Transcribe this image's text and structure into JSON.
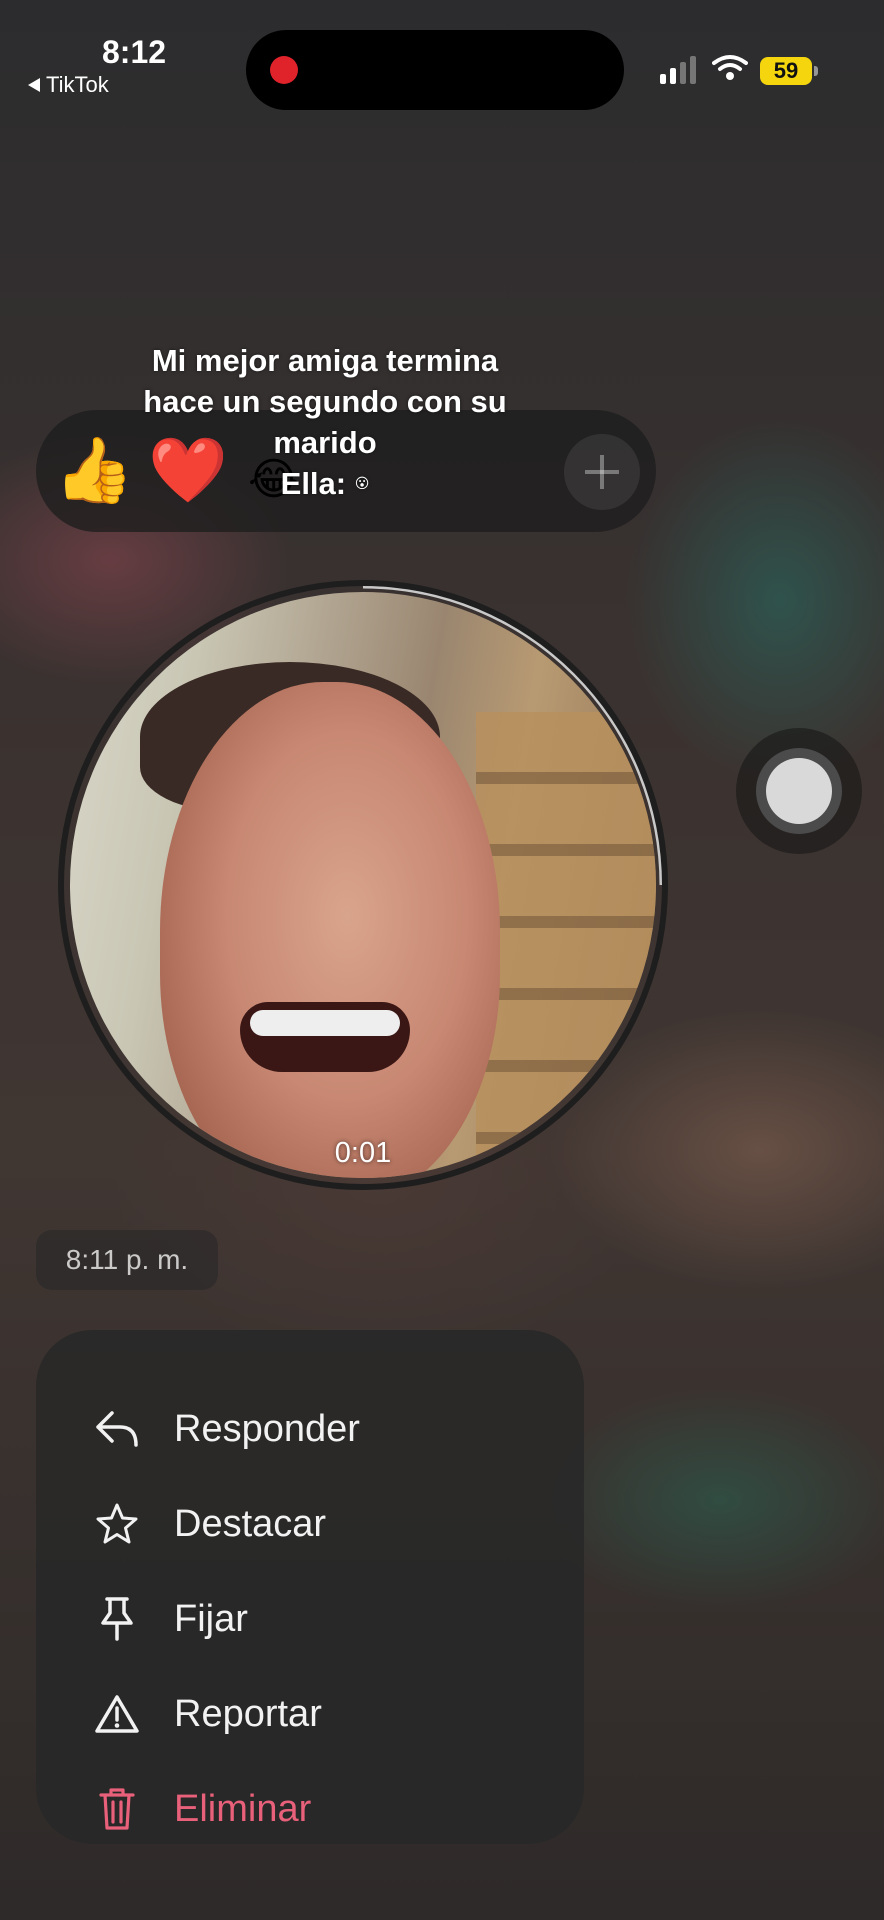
{
  "status_bar": {
    "time": "8:12",
    "back_app": "TikTok",
    "battery": "59",
    "battery_color": "#f5d60e",
    "recording_dot_color": "#e0222b"
  },
  "reactions": {
    "items": [
      {
        "emoji": "👍",
        "name": "thumbs-up"
      },
      {
        "emoji": "❤️",
        "name": "heart"
      },
      {
        "emoji": "😂",
        "name": "laughing"
      }
    ],
    "add_icon": "plus-icon"
  },
  "caption": {
    "line1": "Mi mejor amiga termina",
    "line2": "hace un segundo con su",
    "line3": "marido",
    "line4": "Ella:",
    "line4_emoji": "😮"
  },
  "video_message": {
    "duration": "0:01",
    "progress": 0.25
  },
  "message": {
    "timestamp": "8:11 p. m."
  },
  "context_menu": {
    "items": [
      {
        "label": "Responder",
        "icon": "reply-icon"
      },
      {
        "label": "Destacar",
        "icon": "star-icon"
      },
      {
        "label": "Fijar",
        "icon": "pin-icon"
      },
      {
        "label": "Reportar",
        "icon": "warning-icon"
      },
      {
        "label": "Eliminar",
        "icon": "trash-icon"
      }
    ],
    "danger_color": "#e8607a"
  }
}
